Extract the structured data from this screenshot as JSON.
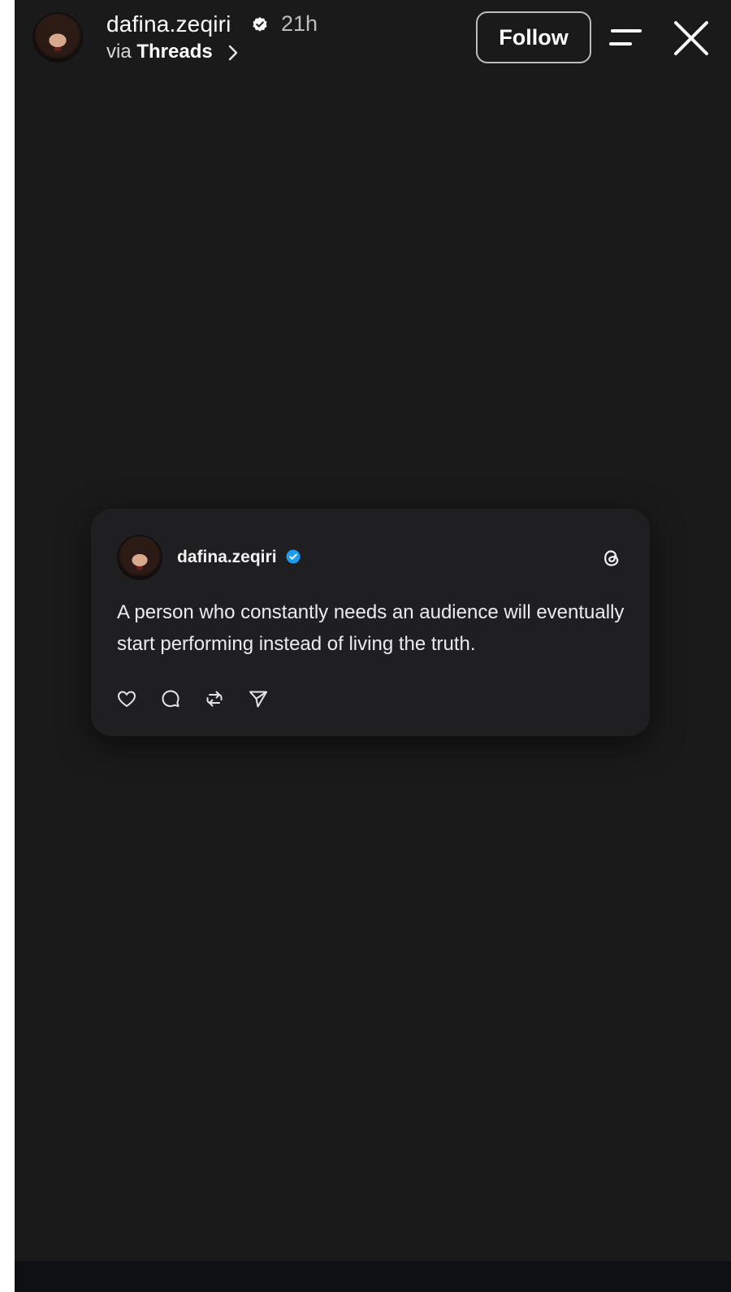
{
  "header": {
    "username": "dafina.zeqiri",
    "time": "21h",
    "via_prefix": "via",
    "via_source": "Threads",
    "follow_label": "Follow"
  },
  "post": {
    "username": "dafina.zeqiri",
    "text": "A person who constantly needs an audience will eventually start performing instead of living the truth."
  },
  "icons": {
    "verified": "verified-badge-icon",
    "chevron": "chevron-right-icon",
    "menu": "menu-icon",
    "close": "close-icon",
    "threads": "threads-logo-icon",
    "like": "heart-icon",
    "comment": "comment-icon",
    "repost": "repost-icon",
    "share": "share-icon"
  },
  "colors": {
    "background": "#1a1a1b",
    "card": "#1f1f22",
    "verified_blue": "#1d9bf0",
    "text": "#ffffff"
  }
}
